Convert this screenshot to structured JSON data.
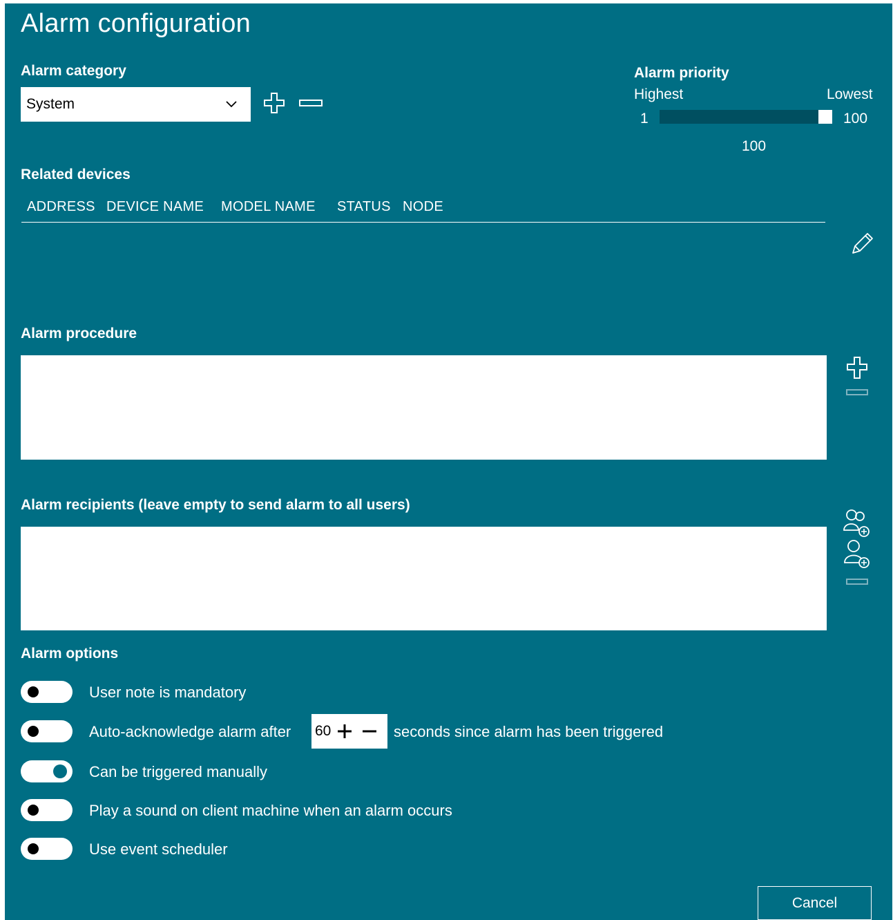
{
  "dialog": {
    "title": "Alarm configuration"
  },
  "category": {
    "label": "Alarm category",
    "selected": "System"
  },
  "priority": {
    "label": "Alarm priority",
    "highest_label": "Highest",
    "lowest_label": "Lowest",
    "min": "1",
    "max": "100",
    "value": "100"
  },
  "devices": {
    "label": "Related devices",
    "columns": [
      "ADDRESS",
      "DEVICE NAME",
      "MODEL NAME",
      "STATUS",
      "NODE"
    ],
    "rows": []
  },
  "procedure": {
    "label": "Alarm procedure"
  },
  "recipients": {
    "label": "Alarm recipients (leave empty to send alarm to all users)"
  },
  "options": {
    "label": "Alarm options",
    "items": [
      {
        "label": "User note is mandatory",
        "on": false
      },
      {
        "label": "Auto-acknowledge alarm after",
        "suffix": "seconds since alarm has been triggered",
        "on": false
      },
      {
        "label": "Can be triggered manually",
        "on": true
      },
      {
        "label": "Play a sound on client machine when an alarm occurs",
        "on": false
      },
      {
        "label": "Use event scheduler",
        "on": false
      }
    ],
    "auto_ack_seconds": "60"
  },
  "buttons": {
    "cancel": "Cancel"
  },
  "colors": {
    "background": "#006e84",
    "slider_track": "#004f60",
    "accent": "#ffffff"
  },
  "icons": [
    "chevron-down-icon",
    "plus-icon",
    "minus-icon",
    "pencil-icon",
    "add-group-icon",
    "add-user-icon"
  ]
}
